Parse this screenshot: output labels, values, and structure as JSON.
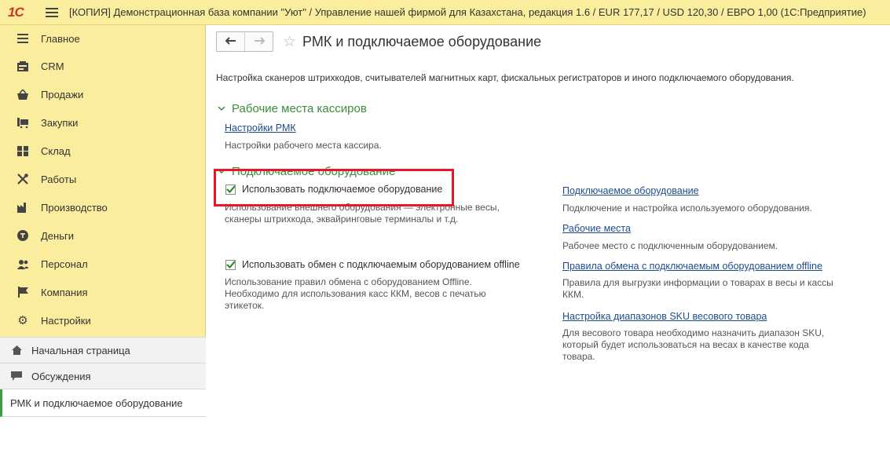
{
  "window": {
    "logo": "1С",
    "title": "[КОПИЯ] Демонстрационная база компании \"Уют\" / Управление нашей фирмой для Казахстана, редакция 1.6 / EUR 177,17 / USD 120,30 / ЕВРО 1,00  (1С:Предприятие)"
  },
  "sidebar": {
    "items": [
      {
        "label": "Главное",
        "icon": "menu-lines-icon"
      },
      {
        "label": "CRM",
        "icon": "crm-icon"
      },
      {
        "label": "Продажи",
        "icon": "basket-icon"
      },
      {
        "label": "Закупки",
        "icon": "cart-icon"
      },
      {
        "label": "Склад",
        "icon": "warehouse-icon"
      },
      {
        "label": "Работы",
        "icon": "tools-icon"
      },
      {
        "label": "Производство",
        "icon": "factory-icon"
      },
      {
        "label": "Деньги",
        "icon": "money-icon"
      },
      {
        "label": "Персонал",
        "icon": "people-icon"
      },
      {
        "label": "Компания",
        "icon": "flag-icon"
      },
      {
        "label": "Настройки",
        "icon": "gear-icon"
      }
    ],
    "open_windows": [
      {
        "label": "Начальная страница",
        "icon": "home-icon"
      },
      {
        "label": "Обсуждения",
        "icon": "chat-icon"
      },
      {
        "label": "РМК и подключаемое оборудование",
        "active": true
      }
    ]
  },
  "main": {
    "title": "РМК и подключаемое оборудование",
    "description": "Настройка сканеров штрихкодов, считывателей магнитных карт, фискальных регистраторов и иного подключаемого оборудования.",
    "section_cashiers": {
      "title": "Рабочие места кассиров",
      "link": "Настройки РМК",
      "note": "Настройки рабочего места кассира."
    },
    "section_equipment": {
      "title": "Подключаемое оборудование",
      "checkbox1": {
        "label": "Использовать подключаемое оборудование",
        "checked": true,
        "note_line1": "Использование внешнего оборудования — электронные весы,",
        "note_line2": "сканеры штрихкода, эквайринговые терминалы и т.д."
      },
      "checkbox2": {
        "label": "Использовать обмен с подключаемым оборудованием offline",
        "checked": true,
        "note_line1": "Использование правил обмена с оборудованием Offline.",
        "note_line2": "Необходимо для использования касс ККМ, весов с печатью",
        "note_line3": "этикеток."
      },
      "right_links": [
        {
          "link": "Подключаемое оборудование",
          "note_line1": "Подключение и настройка используемого оборудования."
        },
        {
          "link": "Рабочие места",
          "note_line1": "Рабочее место с подключенным оборудованием."
        },
        {
          "link": "Правила обмена с подключаемым оборудованием offline",
          "note_line1": "Правила для выгрузки информации о товарах в весы и кассы",
          "note_line2": "ККМ."
        },
        {
          "link": "Настройка диапазонов SKU весового товара",
          "note_line1": "Для весового товара необходимо назначить диапазон SKU,",
          "note_line2": "который будет использоваться на весах в качестве кода",
          "note_line3": "товара."
        }
      ]
    }
  },
  "colors": {
    "sidebar_bg": "#fbed9e",
    "section_title": "#3d8b3d",
    "link": "#1c4d8e",
    "highlight": "#e8182b",
    "checkmark": "#2f8f2f"
  }
}
